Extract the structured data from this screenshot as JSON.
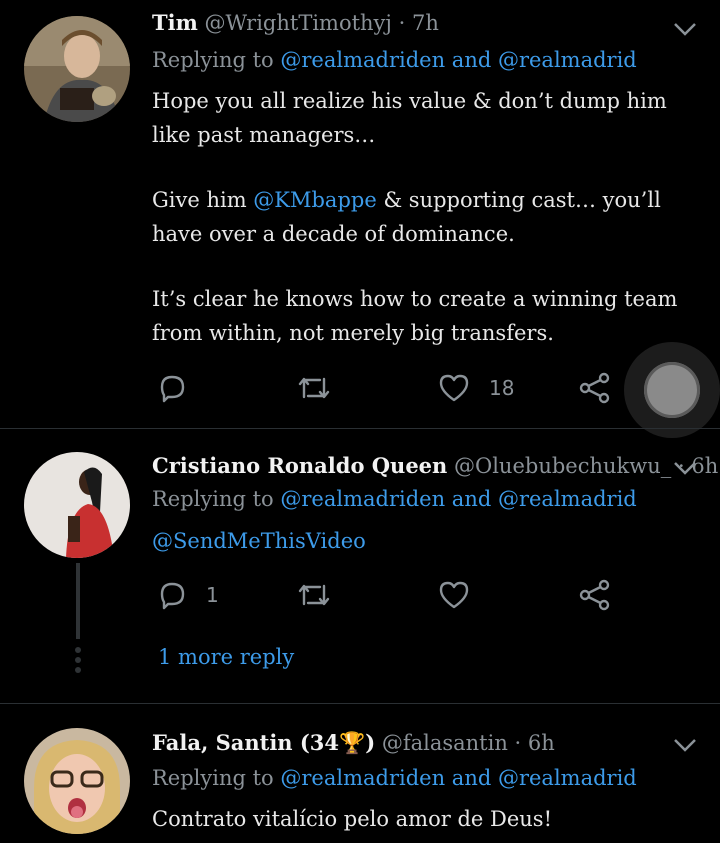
{
  "tweets": [
    {
      "name": "Tim",
      "handle": "@WrightTimothyj",
      "time": "7h",
      "replying_prefix": "Replying to ",
      "reply_to_1": "@realmadriden",
      "reply_and": " and ",
      "reply_to_2": "@realmadrid",
      "body_p1": "Hope you all realize his value & don’t dump him like past managers…",
      "body_p2_pre": "Give him ",
      "body_p2_mention": "@KMbappe",
      "body_p2_post": " & supporting cast… you’ll have over a decade of dominance.",
      "body_p3": "It’s clear he knows how to create a winning team from within, not merely big transfers.",
      "likes": "18"
    },
    {
      "name": "Cristiano Ronaldo Queen",
      "handle": "@Oluebubechukwu_",
      "time": "6h",
      "replying_prefix": "Replying to ",
      "reply_to_1": "@realmadriden",
      "reply_and": " and ",
      "reply_to_2": "@realmadrid",
      "body_mention": "@SendMeThisVideo",
      "replies": "1",
      "more_replies": "1 more reply"
    },
    {
      "name": "Fala, Santin (34",
      "name_trophy": "🏆",
      "name_close": ")",
      "handle": "@falasantin",
      "time": "6h",
      "replying_prefix": "Replying to ",
      "reply_to_1": "@realmadriden",
      "reply_and": " and ",
      "reply_to_2": "@realmadrid",
      "body": "Contrato vitalício pelo amor de Deus!"
    }
  ],
  "separator": "·",
  "icons": [
    "reply-icon",
    "retweet-icon",
    "like-icon",
    "share-icon",
    "chevron-down-icon"
  ],
  "colors": {
    "link": "#3d9be9",
    "muted": "#8b9298",
    "background": "#000000"
  }
}
